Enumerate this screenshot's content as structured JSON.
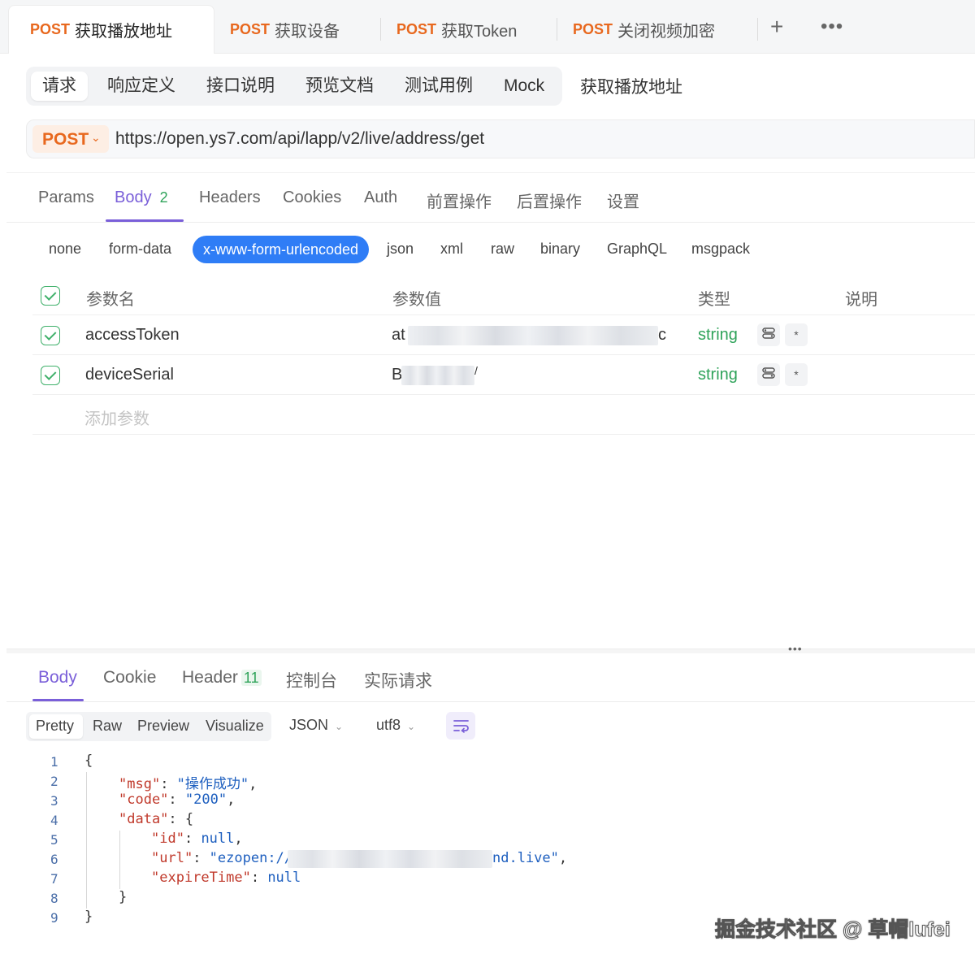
{
  "top_tabs": [
    {
      "method": "POST",
      "name": "获取播放地址"
    },
    {
      "method": "POST",
      "name": "获取设备"
    },
    {
      "method": "POST",
      "name": "获取Token"
    },
    {
      "method": "POST",
      "name": "关闭视频加密"
    }
  ],
  "top_actions": {
    "add": "+",
    "more": "•••"
  },
  "sub_tabs": [
    "请求",
    "响应定义",
    "接口说明",
    "预览文档",
    "测试用例",
    "Mock"
  ],
  "page_name": "获取播放地址",
  "request": {
    "method": "POST",
    "url": "https://open.ys7.com/api/lapp/v2/live/address/get"
  },
  "req_tabs": {
    "params": "Params",
    "body": "Body",
    "body_count": "2",
    "headers": "Headers",
    "cookies": "Cookies",
    "auth": "Auth",
    "pre": "前置操作",
    "post": "后置操作",
    "settings": "设置"
  },
  "body_types": [
    "none",
    "form-data",
    "x-www-form-urlencoded",
    "json",
    "xml",
    "raw",
    "binary",
    "GraphQL",
    "msgpack"
  ],
  "params_table": {
    "headers": [
      "参数名",
      "参数值",
      "类型",
      "说明"
    ],
    "rows": [
      {
        "name": "accessToken",
        "value_start": "at",
        "value_end": "c",
        "type": "string",
        "required": "*"
      },
      {
        "name": "deviceSerial",
        "value_start": "B",
        "value_end": "/",
        "type": "string",
        "required": "*"
      }
    ],
    "add_placeholder": "添加参数"
  },
  "resp_tabs": {
    "body": "Body",
    "cookie": "Cookie",
    "header": "Header",
    "header_count": "11",
    "console": "控制台",
    "actual": "实际请求"
  },
  "resp_format": {
    "modes": [
      "Pretty",
      "Raw",
      "Preview",
      "Visualize"
    ],
    "type": "JSON",
    "encoding": "utf8"
  },
  "code": {
    "line_numbers": [
      "1",
      "2",
      "3",
      "4",
      "5",
      "6",
      "7",
      "8",
      "9"
    ],
    "msg_key": "\"msg\"",
    "msg_val": "\"操作成功\"",
    "code_key": "\"code\"",
    "code_val": "\"200\"",
    "data_key": "\"data\"",
    "id_key": "\"id\"",
    "id_val": "null",
    "url_key": "\"url\"",
    "url_val_start": "\"ezopen://",
    "url_val_end": "nd.live\"",
    "expire_key": "\"expireTime\"",
    "expire_val": "null"
  },
  "watermark": "掘金技术社区 @ 草帽lufei",
  "colors": {
    "accent": "#7a5fd9",
    "method": "#e8681e",
    "type": "#2fa35a",
    "active_pill": "#2f7df6"
  }
}
